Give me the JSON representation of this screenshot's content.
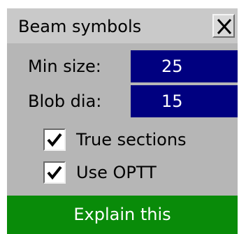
{
  "dialog": {
    "title": "Beam symbols",
    "close_icon": "close-icon"
  },
  "fields": {
    "min_size": {
      "label": "Min size:",
      "value": "25"
    },
    "blob_dia": {
      "label": "Blob dia:",
      "value": "15"
    }
  },
  "options": {
    "true_sections": {
      "label": "True sections",
      "checked": true
    },
    "use_optt": {
      "label": "Use OPTT",
      "checked": true
    }
  },
  "explain_button": {
    "label": "Explain this"
  },
  "colors": {
    "panel": "#b6b6b6",
    "titlebar": "#c9c9c9",
    "input_bg": "#000080",
    "explain_bg": "#098b09"
  }
}
